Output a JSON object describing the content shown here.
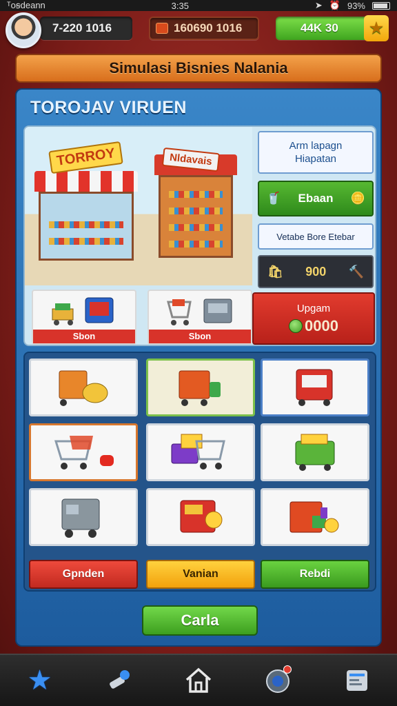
{
  "status_bar": {
    "carrier": "ᵀoꞩdeann",
    "time": "3:35",
    "battery_text": "93%"
  },
  "hud": {
    "coins": "7-220 1016",
    "cash": "160690 1016",
    "gems": "44K 30"
  },
  "title_banner": "Simulasi Bisnies Nalania",
  "panel": {
    "title": "TOROJAV VIRUEN",
    "shop_signs": [
      "TORROY",
      "Nldavais"
    ],
    "mini_cards": [
      {
        "label": "Sbon"
      },
      {
        "label": "Sbon"
      }
    ],
    "side": {
      "info_1_line_1": "Arm lapagn",
      "info_1_line_2": "Hiapatan",
      "green_label": "Ebaan",
      "info_2": "Vetabe Bore Etebar",
      "dark_value": "900",
      "upgrade_title": "Upgam",
      "upgrade_cost": "0000"
    }
  },
  "grid": {
    "action_buttons": {
      "red": "Gpnden",
      "yellow": "Vanian",
      "green": "Rebdi"
    }
  },
  "main_button": "Carla",
  "colors": {
    "accent_red": "#d8332a",
    "accent_green": "#3fa51f",
    "accent_yellow": "#f2a70c",
    "panel_blue": "#2a70b4"
  },
  "bottom_nav": {
    "icons": [
      "star-icon",
      "tools-icon",
      "home-icon",
      "camera-icon",
      "news-icon"
    ]
  }
}
